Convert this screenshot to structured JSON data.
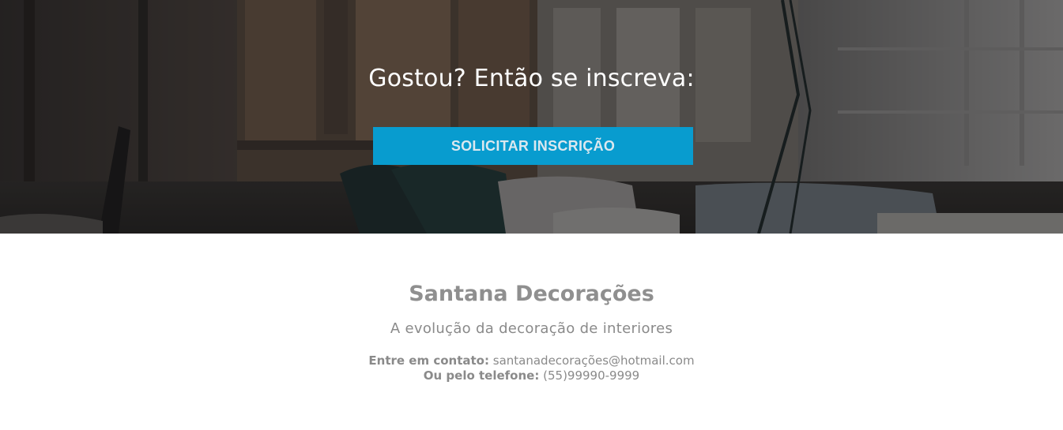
{
  "hero": {
    "title": "Gostou? Então se inscreva:",
    "cta_label": "SOLICITAR INSCRIÇÃO",
    "cta_color": "#089ccf"
  },
  "footer": {
    "brand_name": "Santana Decorações",
    "tagline": "A evolução da decoração de interiores",
    "email_label": "Entre em contato:",
    "email_value": "santanadecorações@hotmail.com",
    "phone_label": "Ou pelo telefone:",
    "phone_value": "(55)99990-9999"
  }
}
